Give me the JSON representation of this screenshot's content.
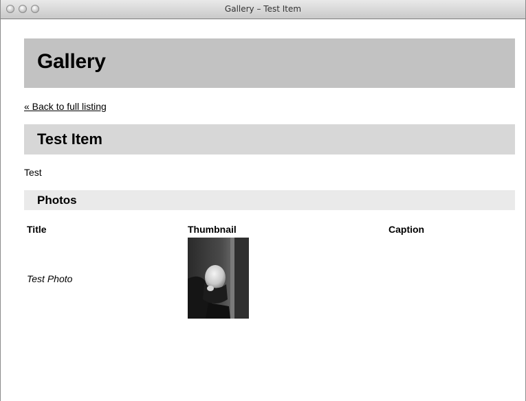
{
  "window": {
    "title": "Gallery – Test Item"
  },
  "header": {
    "title": "Gallery"
  },
  "nav": {
    "back_link": "« Back to full listing"
  },
  "item": {
    "title": "Test Item",
    "description": "Test"
  },
  "photos": {
    "heading": "Photos",
    "columns": [
      "Title",
      "Thumbnail",
      "Caption"
    ],
    "rows": [
      {
        "title": "Test Photo",
        "caption": ""
      }
    ]
  },
  "colors": {
    "header_bg": "#c2c2c2",
    "item_header_bg": "#d7d7d7",
    "photos_header_bg": "#eaeaea"
  }
}
